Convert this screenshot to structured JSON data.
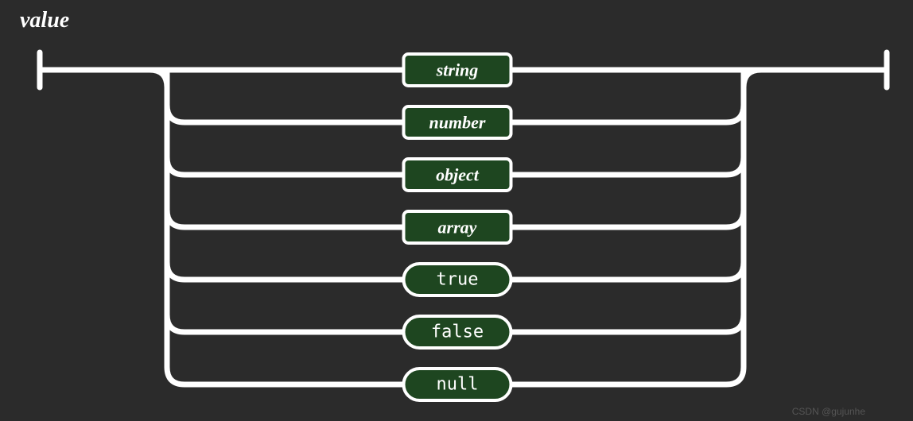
{
  "title": "value",
  "options": [
    {
      "label": "string",
      "shape": "rect",
      "italic": true
    },
    {
      "label": "number",
      "shape": "rect",
      "italic": true
    },
    {
      "label": "object",
      "shape": "rect",
      "italic": true
    },
    {
      "label": "array",
      "shape": "rect",
      "italic": true
    },
    {
      "label": "true",
      "shape": "round",
      "italic": false
    },
    {
      "label": "false",
      "shape": "round",
      "italic": false
    },
    {
      "label": "null",
      "shape": "round",
      "italic": false
    }
  ],
  "colors": {
    "bg": "#2b2b2b",
    "rail": "#ffffff",
    "box_fill": "#1e4620",
    "box_stroke": "#ffffff",
    "text": "#ffffff"
  },
  "watermark": "CSDN @gujunhe",
  "watermark2": ""
}
